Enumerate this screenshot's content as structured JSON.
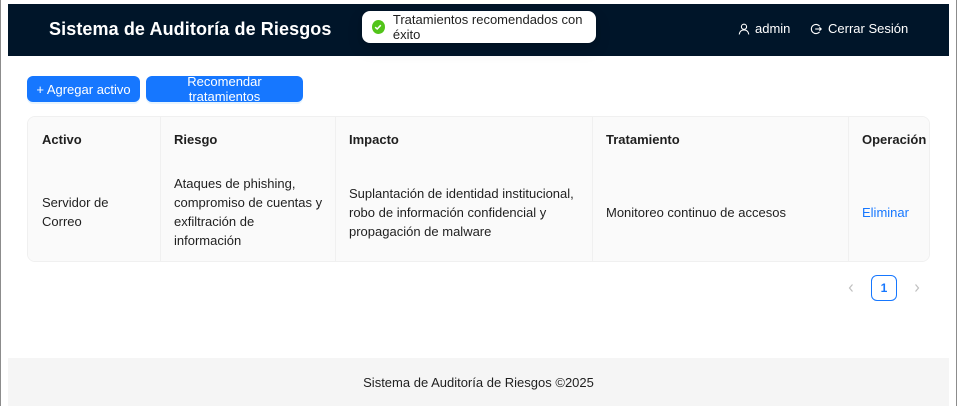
{
  "header": {
    "title": "Sistema de Auditoría de Riesgos",
    "user_label": "admin",
    "logout_label": "Cerrar Sesión"
  },
  "toast": {
    "message": "Tratamientos recomendados con éxito",
    "status": "success"
  },
  "toolbar": {
    "add_label": "+ Agregar activo",
    "recommend_label": "Recomendar tratamientos"
  },
  "table": {
    "columns": [
      "Activo",
      "Riesgo",
      "Impacto",
      "Tratamiento",
      "Operación"
    ],
    "rows": [
      {
        "activo": "Servidor de Correo",
        "riesgo": "Ataques de phishing, compromiso de cuentas y exfiltración de información",
        "impacto": "Suplantación de identidad institucional, robo de información confidencial y propagación de malware",
        "tratamiento": "Monitoreo continuo de accesos",
        "operacion": "Eliminar"
      }
    ]
  },
  "pagination": {
    "current_page": "1"
  },
  "footer": {
    "text": "Sistema de Auditoría de Riesgos ©2025"
  },
  "colors": {
    "header_bg": "#001529",
    "primary": "#1677ff",
    "success": "#52c41a"
  }
}
